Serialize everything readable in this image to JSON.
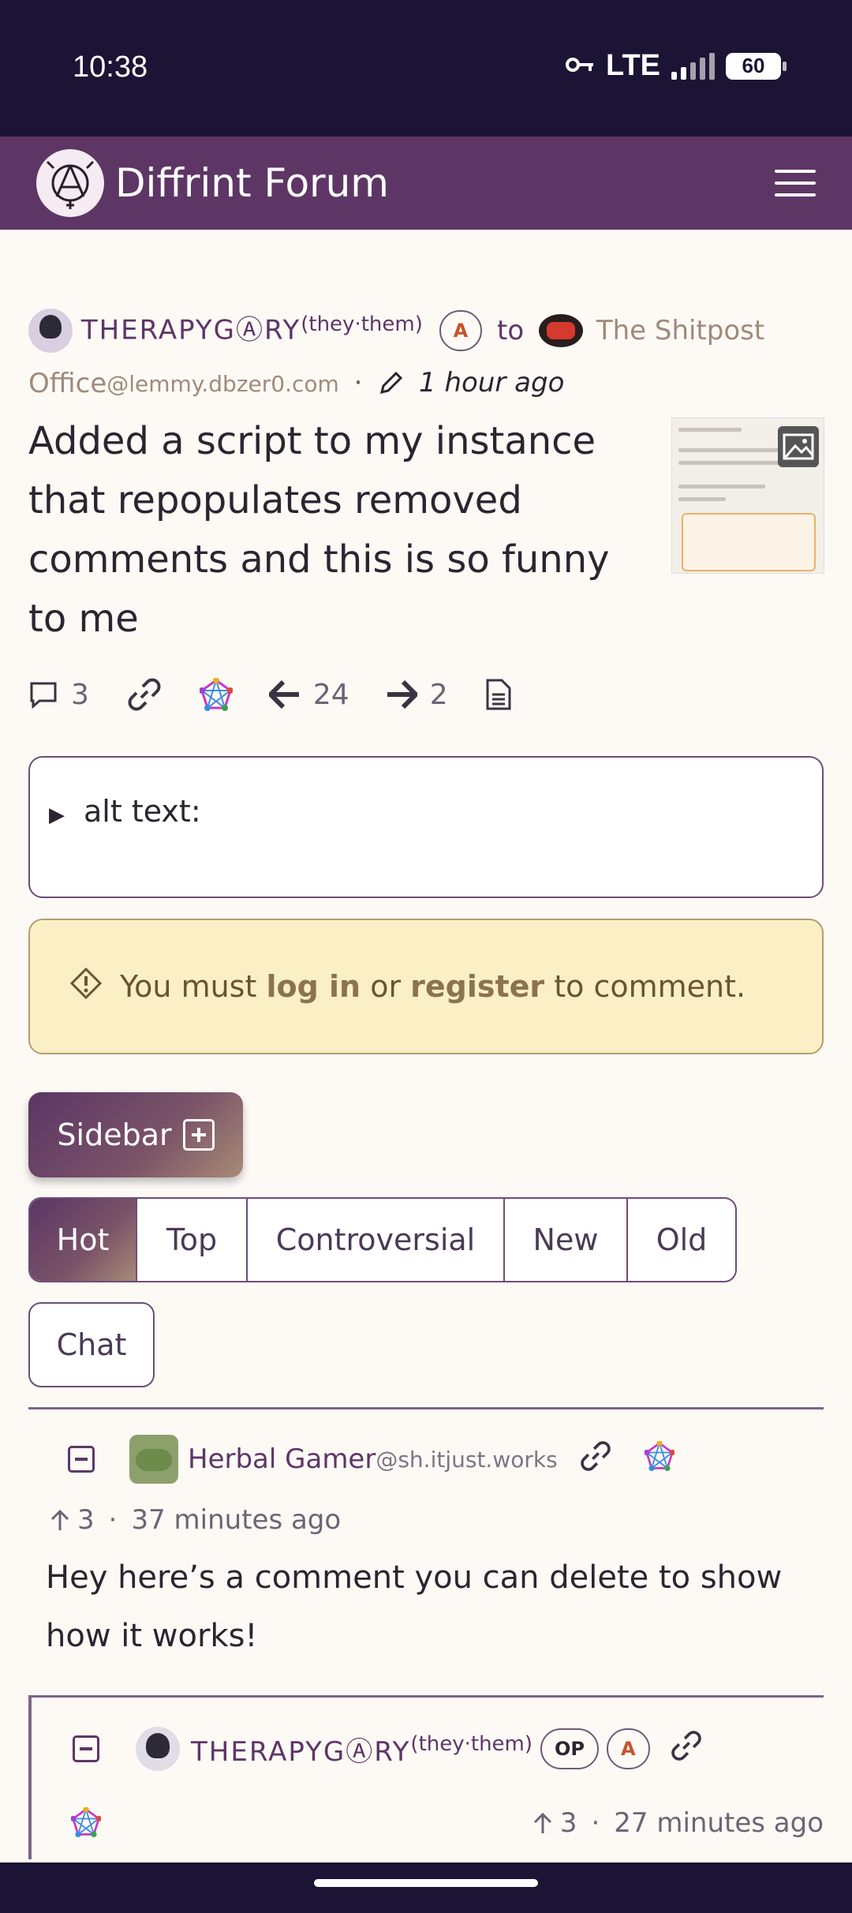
{
  "status_bar": {
    "time": "10:38",
    "network": "LTE",
    "battery": "60"
  },
  "app": {
    "title": "Diffrint Forum"
  },
  "post": {
    "author": "THERAPYGⒶRY",
    "pronouns": "(they·them)",
    "author_badge": "A",
    "to_label": "to",
    "community": "The Shitpost Office",
    "community_instance": "@lemmy.dbzer0.com",
    "separator": "·",
    "time_ago": "1 hour ago",
    "title": "Added a script to my instance that repopulates removed comments and this is so funny to me",
    "comment_count": "3",
    "upvotes": "24",
    "downvotes": "2"
  },
  "alt_text": {
    "label": "alt text:"
  },
  "login_notice": {
    "prefix": "You must ",
    "login": "log in",
    "middle": " or ",
    "register": "register",
    "suffix": " to comment."
  },
  "sidebar_button": {
    "label": "Sidebar"
  },
  "sort_tabs": [
    "Hot",
    "Top",
    "Controversial",
    "New",
    "Old"
  ],
  "sort_selected": "Hot",
  "chat_tab": "Chat",
  "comments": [
    {
      "author": "Herbal Gamer",
      "instance": "@sh.itjust.works",
      "score": "3",
      "separator": "·",
      "time_ago": "37 minutes ago",
      "body": "Hey here’s a comment you can delete to show how it works!"
    },
    {
      "author": "THERAPYGⒶRY",
      "pronouns": "(they·them)",
      "op_badge": "OP",
      "admin_badge": "A",
      "score": "3",
      "separator": "·",
      "time_ago": "27 minutes ago"
    }
  ],
  "colors": {
    "header_bg": "#5e3666",
    "status_bg": "#1c1434",
    "accent": "#5e3666",
    "notice_bg": "#fbefc6"
  }
}
